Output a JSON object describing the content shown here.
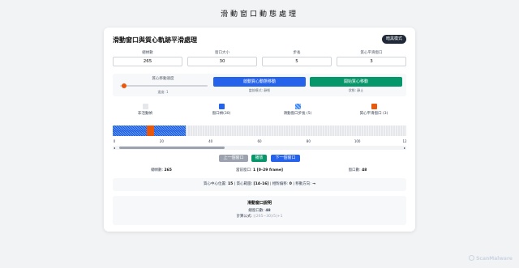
{
  "page": {
    "title": "滑動窗口動態處理"
  },
  "card": {
    "title": "滑動窗口與質心軌跡平滑處理",
    "theme_button": "暗黑模式"
  },
  "params": [
    {
      "label": "總幀數",
      "value": "265"
    },
    {
      "label": "窗口大小",
      "value": "30"
    },
    {
      "label": "步長",
      "value": "5"
    },
    {
      "label": "質心平滑窗口",
      "value": "3"
    }
  ],
  "speed": {
    "label": "質心移動速度",
    "text": "速度: 1",
    "level": 0.02
  },
  "actions": {
    "start": {
      "label": "啟動質心動態移動",
      "status": "當前模式: 靜態",
      "color": "#2563eb"
    },
    "play": {
      "label": "開始質心移動",
      "status": "狀態: 靜止",
      "color": "#059669"
    }
  },
  "legend": [
    {
      "label": "非活動幀",
      "color": "#e5e7eb"
    },
    {
      "label": "窗口幀(30)",
      "color": "#2563eb"
    },
    {
      "label": "滑動窗口步長 (5)",
      "color": "#3b82f6"
    },
    {
      "label": "質心平滑窗口 (3)",
      "color": "#ea580c"
    }
  ],
  "track": {
    "active_frames": 30,
    "centroid_frames": [
      14,
      15,
      16
    ],
    "visible_frames": 120
  },
  "axis_ticks": [
    "0",
    "20",
    "40",
    "60",
    "80",
    "100",
    "12"
  ],
  "nav": {
    "prev": "上一個窗口",
    "play": "播放",
    "next": "下一個窗口"
  },
  "stats": {
    "total_label": "總幀數: ",
    "total_value": "265",
    "current_label": "當前窗口: ",
    "current_value": "1 [0–29 frame]",
    "count_label": "窗口數: ",
    "count_value": "48"
  },
  "info": {
    "center_label": "質心中心位置: ",
    "center_value": "15",
    "range_label": " | 質心範圍: ",
    "range_value": "[14–16]",
    "offset_label": " | 相對偏移: ",
    "offset_value": "0",
    "dir_label": " | 移動方向: ",
    "dir_value": "→"
  },
  "explain": {
    "title": "滑動窗口說明",
    "count_label": "總窗口數: ",
    "count_value": "48",
    "formula_label": "計算公式: ",
    "formula_value": "⌊(265−30)/5⌋+1"
  },
  "watermark": "ScanMalware"
}
